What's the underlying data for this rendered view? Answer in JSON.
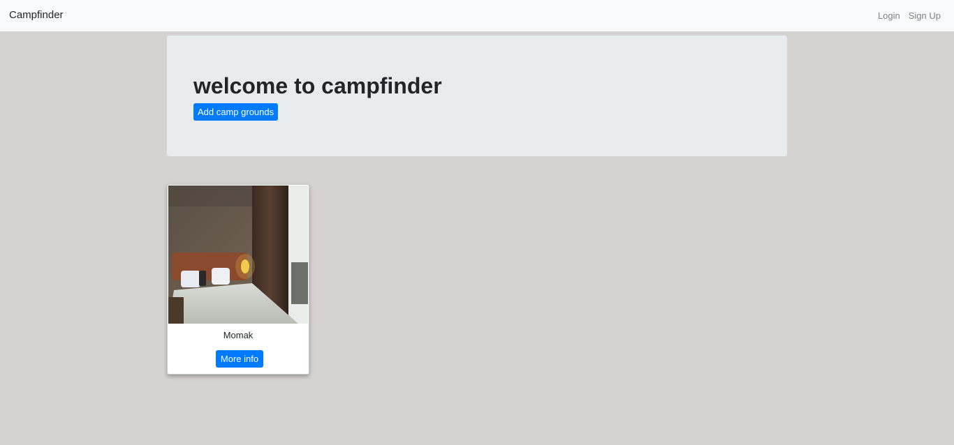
{
  "navbar": {
    "brand": "Campfinder",
    "links": [
      {
        "label": "Login"
      },
      {
        "label": "Sign Up"
      }
    ]
  },
  "hero": {
    "title": "welcome to campfinder",
    "add_button_label": "Add camp grounds"
  },
  "campgrounds": [
    {
      "name": "Momak",
      "image_alt": "hotel room photo",
      "button_label": "More info"
    }
  ],
  "colors": {
    "page_background": "#d6d2d1",
    "navbar_background": "#f8f9fa",
    "jumbotron_background": "#e9ecef",
    "primary_button": "#007bff"
  }
}
